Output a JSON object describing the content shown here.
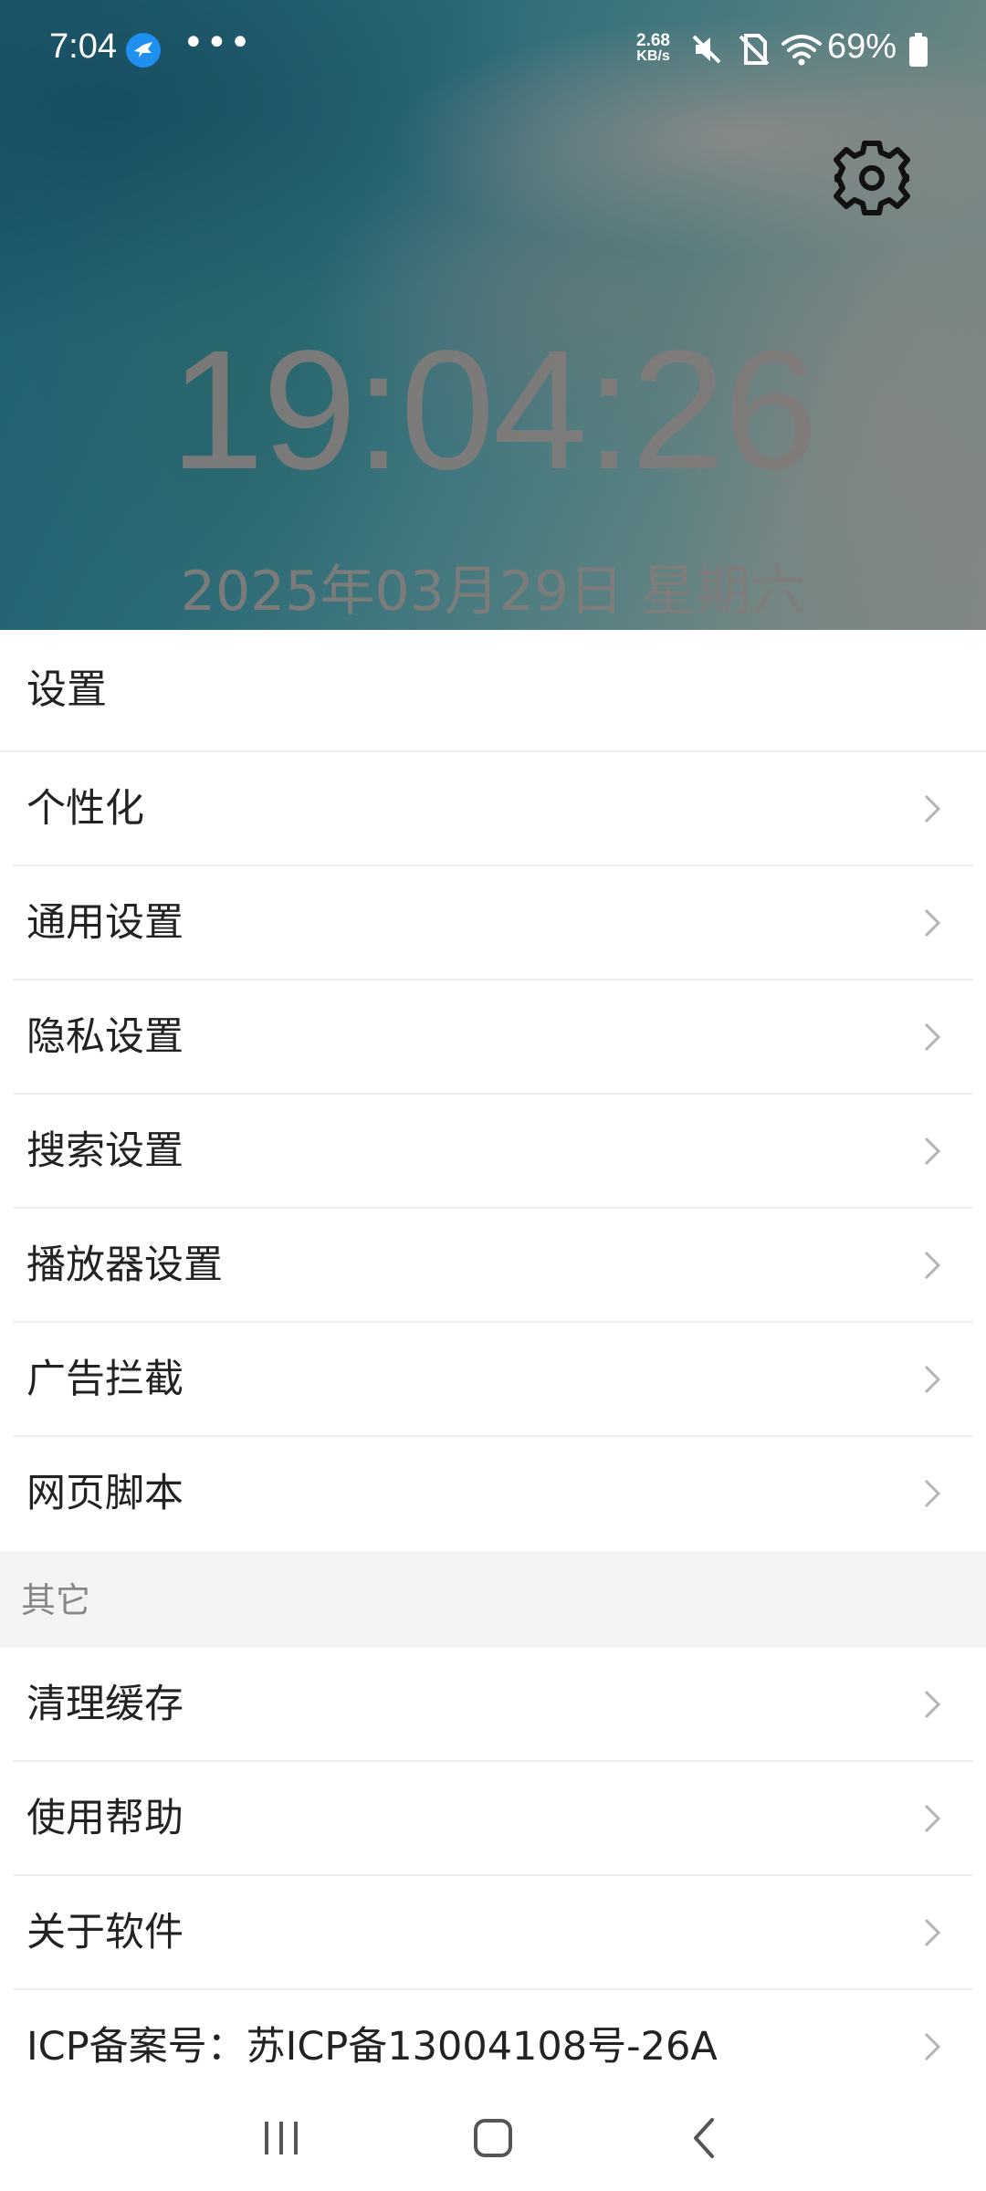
{
  "status_bar": {
    "time": "7:04",
    "more_indicator": "•••",
    "net_speed_value": "2.68",
    "net_speed_unit": "KB/s",
    "battery": "69%",
    "icons": [
      "notification-app-icon",
      "mute-icon",
      "no-sim-icon",
      "wifi-icon",
      "battery-icon"
    ]
  },
  "header": {
    "clock": "19:04:26",
    "date": "2025年03月29日 星期六",
    "settings_icon": "gear-icon"
  },
  "settings": {
    "title": "设置",
    "items": [
      {
        "label": "个性化"
      },
      {
        "label": "通用设置"
      },
      {
        "label": "隐私设置"
      },
      {
        "label": "搜索设置"
      },
      {
        "label": "播放器设置"
      },
      {
        "label": "广告拦截"
      },
      {
        "label": "网页脚本"
      }
    ]
  },
  "other": {
    "title": "其它",
    "items": [
      {
        "label": "清理缓存"
      },
      {
        "label": "使用帮助"
      },
      {
        "label": "关于软件"
      },
      {
        "label": "ICP备案号：苏ICP备13004108号-26A"
      }
    ]
  },
  "nav_bar": {
    "icons": [
      "recent-apps-icon",
      "home-icon",
      "back-icon"
    ]
  },
  "colors": {
    "divider": "#ededed",
    "group_bg": "#f4f4f4",
    "text": "#222222",
    "chevron": "#b5b5b5"
  }
}
